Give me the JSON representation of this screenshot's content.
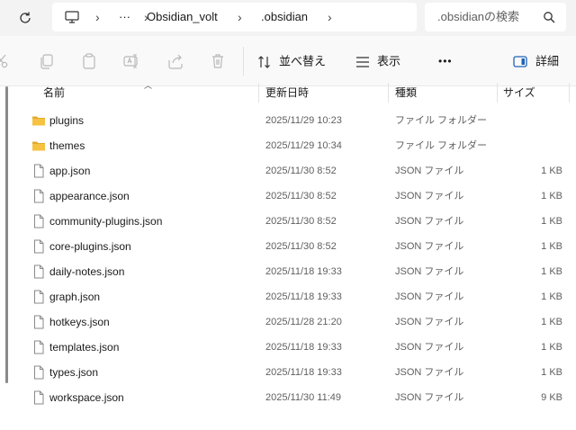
{
  "address_bar": {
    "breadcrumb": [
      "Obsidian_volt",
      ".obsidian"
    ],
    "overflow_label": "···"
  },
  "search": {
    "placeholder": ".obsidianの検索"
  },
  "toolbar": {
    "sort_label": "並べ替え",
    "view_label": "表示",
    "more_label": "•••",
    "details_label": "詳細"
  },
  "columns": {
    "name": "名前",
    "modified": "更新日時",
    "type": "種類",
    "size": "サイズ"
  },
  "files": [
    {
      "name": "plugins",
      "modified": "2025/11/29 10:23",
      "type": "ファイル フォルダー",
      "size": "",
      "kind": "folder"
    },
    {
      "name": "themes",
      "modified": "2025/11/29 10:34",
      "type": "ファイル フォルダー",
      "size": "",
      "kind": "folder"
    },
    {
      "name": "app.json",
      "modified": "2025/11/30 8:52",
      "type": "JSON ファイル",
      "size": "1 KB",
      "kind": "file"
    },
    {
      "name": "appearance.json",
      "modified": "2025/11/30 8:52",
      "type": "JSON ファイル",
      "size": "1 KB",
      "kind": "file"
    },
    {
      "name": "community-plugins.json",
      "modified": "2025/11/30 8:52",
      "type": "JSON ファイル",
      "size": "1 KB",
      "kind": "file"
    },
    {
      "name": "core-plugins.json",
      "modified": "2025/11/30 8:52",
      "type": "JSON ファイル",
      "size": "1 KB",
      "kind": "file"
    },
    {
      "name": "daily-notes.json",
      "modified": "2025/11/18 19:33",
      "type": "JSON ファイル",
      "size": "1 KB",
      "kind": "file"
    },
    {
      "name": "graph.json",
      "modified": "2025/11/18 19:33",
      "type": "JSON ファイル",
      "size": "1 KB",
      "kind": "file"
    },
    {
      "name": "hotkeys.json",
      "modified": "2025/11/28 21:20",
      "type": "JSON ファイル",
      "size": "1 KB",
      "kind": "file"
    },
    {
      "name": "templates.json",
      "modified": "2025/11/18 19:33",
      "type": "JSON ファイル",
      "size": "1 KB",
      "kind": "file"
    },
    {
      "name": "types.json",
      "modified": "2025/11/18 19:33",
      "type": "JSON ファイル",
      "size": "1 KB",
      "kind": "file"
    },
    {
      "name": "workspace.json",
      "modified": "2025/11/30 11:49",
      "type": "JSON ファイル",
      "size": "9 KB",
      "kind": "file"
    }
  ],
  "colors": {
    "folder": "#f5c242",
    "folder_dark": "#e3a92c",
    "accent": "#1f63b8"
  }
}
